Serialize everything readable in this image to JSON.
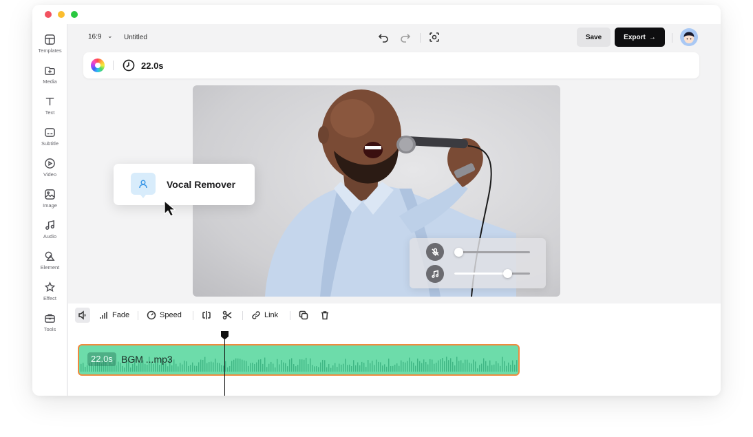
{
  "sidebar": {
    "items": [
      {
        "label": "Templates",
        "icon": "templates-icon"
      },
      {
        "label": "Media",
        "icon": "media-icon"
      },
      {
        "label": "Text",
        "icon": "text-icon"
      },
      {
        "label": "Subtitle",
        "icon": "subtitle-icon"
      },
      {
        "label": "Video",
        "icon": "video-icon"
      },
      {
        "label": "Image",
        "icon": "image-icon"
      },
      {
        "label": "Audio",
        "icon": "audio-icon"
      },
      {
        "label": "Element",
        "icon": "element-icon"
      },
      {
        "label": "Effect",
        "icon": "effect-icon"
      },
      {
        "label": "Tools",
        "icon": "tools-icon"
      }
    ]
  },
  "topbar": {
    "aspect_ratio": "16:9",
    "title": "Untitled",
    "save_label": "Save",
    "export_label": "Export"
  },
  "infobar": {
    "duration": "22.0s"
  },
  "canvas": {
    "popup_label": "Vocal Remover",
    "vocal_volume": 0.05,
    "music_volume": 0.7
  },
  "timeline": {
    "tools": {
      "fade": "Fade",
      "speed": "Speed",
      "link": "Link"
    },
    "clip": {
      "duration": "22.0s",
      "name": "BGM ...mp3"
    }
  },
  "colors": {
    "accent": "#0e0e10",
    "clip_fill": "#6ddcaa",
    "clip_border": "#f08a3e",
    "popup_icon_bg": "#d8ecfb"
  }
}
